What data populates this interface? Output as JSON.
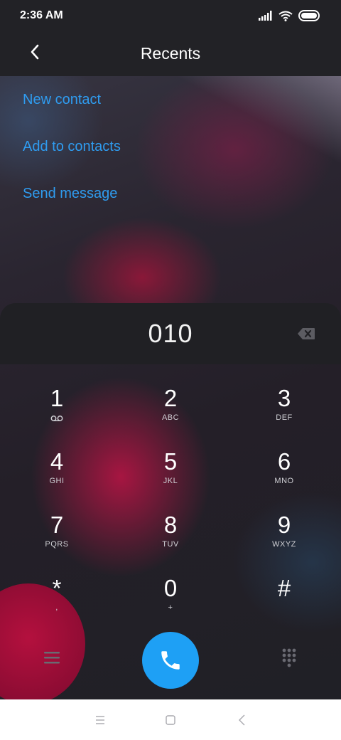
{
  "status_bar": {
    "time": "2:36 AM"
  },
  "header": {
    "title": "Recents"
  },
  "actions": [
    {
      "label": "New contact"
    },
    {
      "label": "Add to contacts"
    },
    {
      "label": "Send message"
    }
  ],
  "dialpad": {
    "number": "010",
    "keys": [
      {
        "digit": "1",
        "letters": ""
      },
      {
        "digit": "2",
        "letters": "ABC"
      },
      {
        "digit": "3",
        "letters": "DEF"
      },
      {
        "digit": "4",
        "letters": "GHI"
      },
      {
        "digit": "5",
        "letters": "JKL"
      },
      {
        "digit": "6",
        "letters": "MNO"
      },
      {
        "digit": "7",
        "letters": "PQRS"
      },
      {
        "digit": "8",
        "letters": "TUV"
      },
      {
        "digit": "9",
        "letters": "WXYZ"
      },
      {
        "digit": "*",
        "letters": ","
      },
      {
        "digit": "0",
        "letters": "+"
      },
      {
        "digit": "#",
        "letters": ""
      }
    ]
  },
  "colors": {
    "accent": "#2f9cf0",
    "call_button": "#1ea0f5",
    "bar_background": "#222226"
  },
  "icons": {
    "back": "chevron-left-icon",
    "backspace": "backspace-icon",
    "voicemail": "voicemail-icon",
    "menu": "menu-icon",
    "call": "phone-icon",
    "keypad": "dialpad-icon"
  }
}
